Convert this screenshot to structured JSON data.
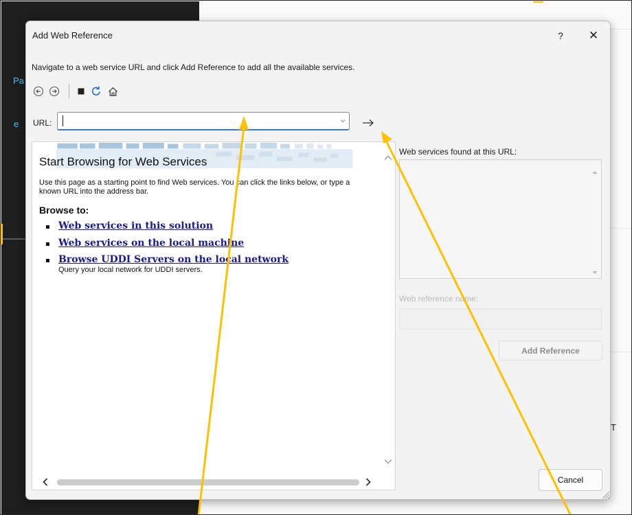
{
  "background": {
    "fragments": [
      "Pa",
      "e"
    ],
    "right_fragment": "T"
  },
  "dialog": {
    "title": "Add Web Reference",
    "help_label": "?",
    "close_label": "✕",
    "instruction": "Navigate to a web service URL and click Add Reference to add all the available services."
  },
  "toolbar": {
    "icons": [
      "back-icon",
      "forward-icon",
      "stop-icon",
      "refresh-icon",
      "home-icon"
    ]
  },
  "url": {
    "label": "URL:",
    "value": ""
  },
  "browser": {
    "title": "Start Browsing for Web Services",
    "intro": "Use this page as a starting point to find Web services. You can click the links below, or type a known URL into the address bar.",
    "browse_to": "Browse to:",
    "links": [
      "Web services in this solution",
      "Web services on the local machine",
      "Browse UDDI Servers on the local network"
    ],
    "uddi_desc": "Query your local network for UDDI servers."
  },
  "right_panel": {
    "found_label": "Web services found at this URL:",
    "ref_name_label": "Web reference name:",
    "ref_name_value": "",
    "add_reference_label": "Add Reference"
  },
  "footer": {
    "cancel_label": "Cancel"
  },
  "colors": {
    "annotation": "#ffc000",
    "link": "#1a1a8c",
    "focus": "#3c7ac4"
  }
}
